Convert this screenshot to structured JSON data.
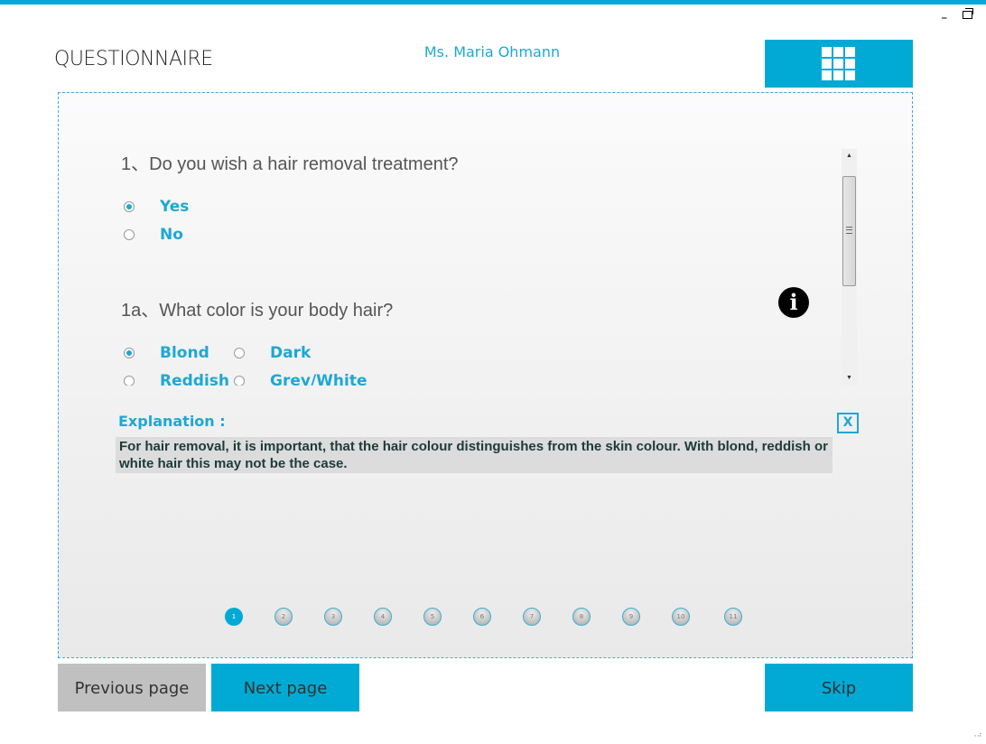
{
  "window": {
    "minimize_label": "_",
    "restore_icon": "restore-icon"
  },
  "header": {
    "title": "QUESTIONNAIRE",
    "user_name": "Ms. Maria Ohmann",
    "menu_icon": "grid-menu-icon"
  },
  "questions": [
    {
      "number": "1、",
      "text": "Do you wish a hair removal treatment?",
      "options": [
        {
          "label": "Yes",
          "checked": true
        },
        {
          "label": "No",
          "checked": false
        }
      ]
    },
    {
      "number": "1a、",
      "text": "What color is your body hair?",
      "info_icon": "info-icon",
      "options": [
        {
          "label": "Blond",
          "checked": true
        },
        {
          "label": "Dark",
          "checked": false
        },
        {
          "label": "Reddish",
          "checked": false
        },
        {
          "label": "Grey/White",
          "checked": false
        }
      ]
    }
  ],
  "scrollbar": {
    "up_arrow": "▲",
    "down_arrow": "▼"
  },
  "explanation": {
    "title": "Explanation :",
    "close_label": "X",
    "text": "For hair removal, it is important, that the hair colour distinguishes from the skin colour. With blond, reddish or white hair this may not be the case."
  },
  "pagination": {
    "current_page": 1,
    "pages": [
      "1",
      "2",
      "3",
      "4",
      "5",
      "6",
      "7",
      "8",
      "9",
      "10",
      "11"
    ]
  },
  "footer": {
    "previous_label": "Previous page",
    "next_label": "Next page",
    "skip_label": "Skip"
  },
  "colors": {
    "accent": "#00aad4",
    "accent_text": "#1ea8d2",
    "disabled_button": "#c0c0c0"
  }
}
